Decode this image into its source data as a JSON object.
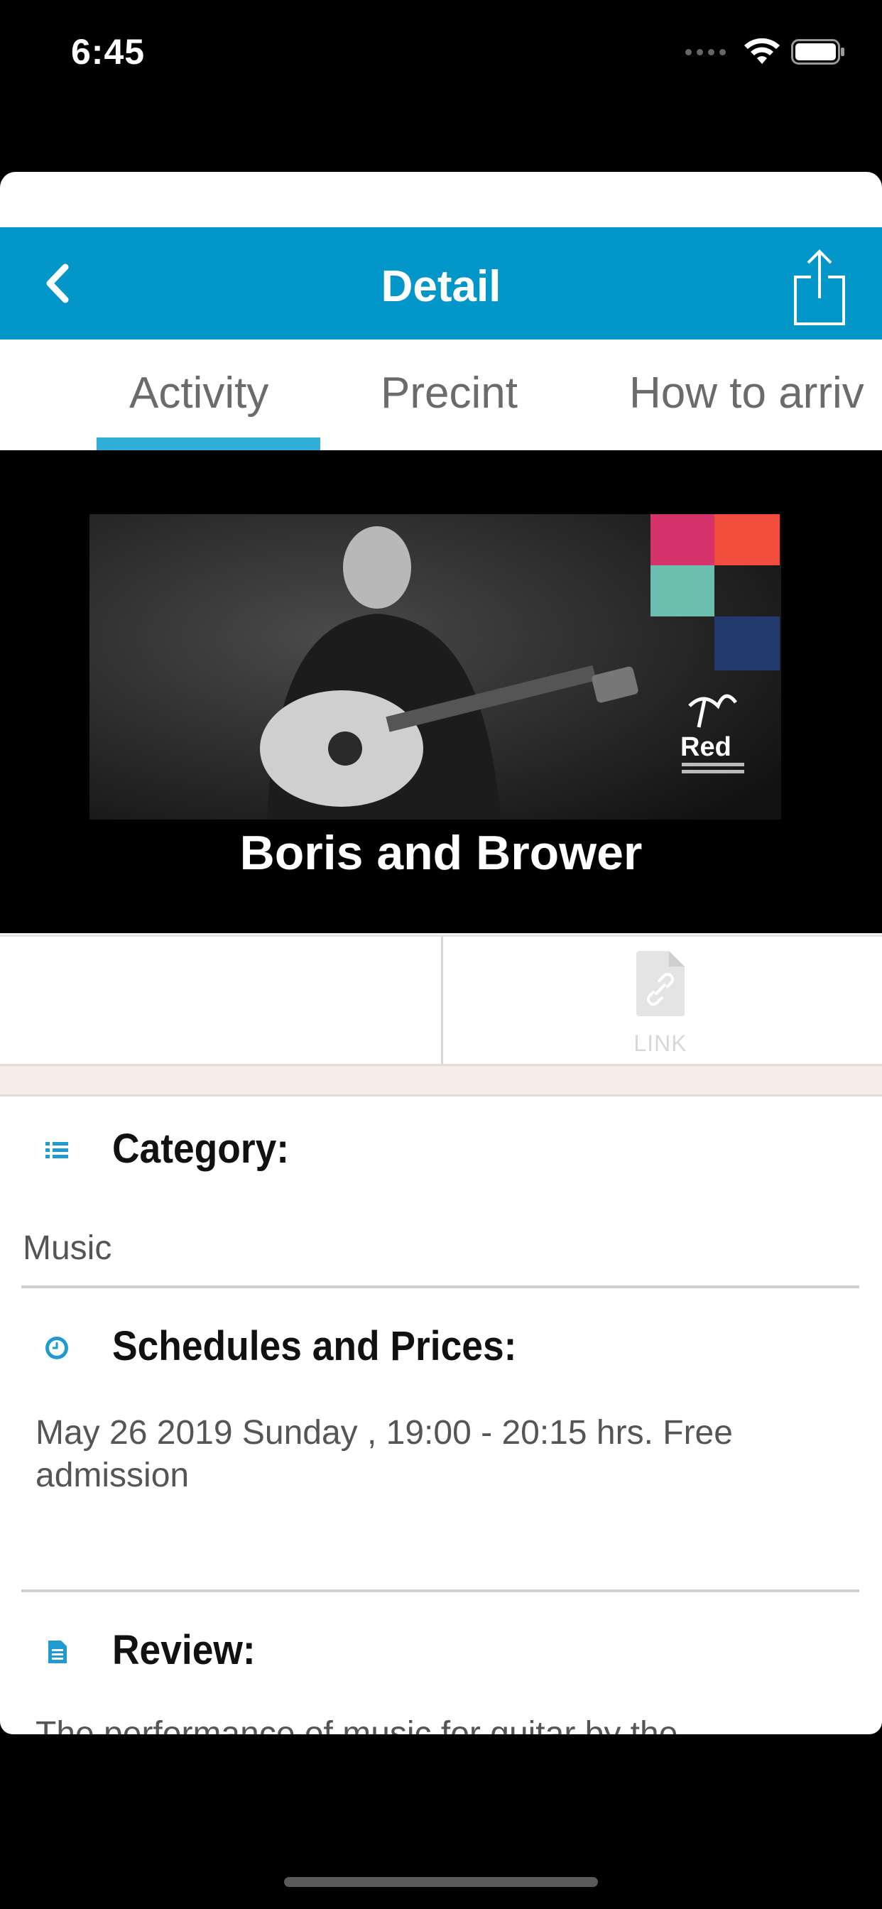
{
  "status_bar": {
    "time": "6:45"
  },
  "nav": {
    "title": "Detail",
    "back_icon": "chevron-left-icon",
    "share_icon": "share-icon"
  },
  "tabs": [
    {
      "label": "Activity",
      "selected": true
    },
    {
      "label": "Precint",
      "selected": false
    },
    {
      "label": "How to arriv",
      "selected": false
    }
  ],
  "hero": {
    "title": "Boris and Brower",
    "logo_text": "Red"
  },
  "actions": {
    "link_label": "LINK"
  },
  "sections": {
    "category": {
      "heading": "Category:",
      "value": "Music"
    },
    "schedules": {
      "heading": "Schedules and Prices:",
      "value": "May 26 2019 Sunday  , 19:00 - 20:15 hrs. Free admission"
    },
    "review": {
      "heading": "Review:",
      "value": "The performance of music for guitar by the"
    }
  },
  "colors": {
    "accent": "#0396c9",
    "tab_indicator": "#2eaed8"
  }
}
